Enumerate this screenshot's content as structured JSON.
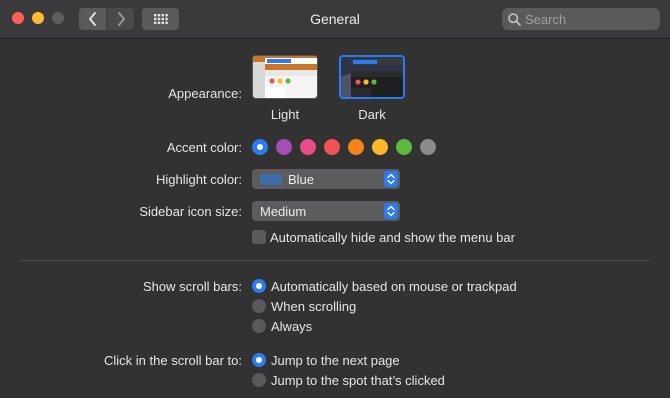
{
  "window": {
    "title": "General"
  },
  "toolbar": {
    "search_placeholder": "Search"
  },
  "appearance": {
    "label": "Appearance:",
    "options": [
      {
        "name": "Light",
        "selected": false
      },
      {
        "name": "Dark",
        "selected": true
      }
    ]
  },
  "accent_color": {
    "label": "Accent color:",
    "colors": [
      {
        "name": "blue",
        "hex": "#2b7bf3",
        "selected": true
      },
      {
        "name": "purple",
        "hex": "#a24fb6"
      },
      {
        "name": "pink",
        "hex": "#e84d8a"
      },
      {
        "name": "red",
        "hex": "#f15253"
      },
      {
        "name": "orange",
        "hex": "#f7821b"
      },
      {
        "name": "yellow",
        "hex": "#fbb829"
      },
      {
        "name": "green",
        "hex": "#5fb83e"
      },
      {
        "name": "graphite",
        "hex": "#8c8c8c"
      }
    ]
  },
  "highlight_color": {
    "label": "Highlight color:",
    "value": "Blue",
    "swatch": "#3e6ca8"
  },
  "sidebar_icon_size": {
    "label": "Sidebar icon size:",
    "value": "Medium"
  },
  "menu_bar": {
    "label": "Automatically hide and show the menu bar",
    "checked": false
  },
  "scroll_bars": {
    "label": "Show scroll bars:",
    "options": [
      {
        "label": "Automatically based on mouse or trackpad",
        "selected": true
      },
      {
        "label": "When scrolling",
        "selected": false
      },
      {
        "label": "Always",
        "selected": false
      }
    ]
  },
  "click_scroll": {
    "label": "Click in the scroll bar to:",
    "options": [
      {
        "label": "Jump to the next page",
        "selected": true
      },
      {
        "label": "Jump to the spot that’s clicked",
        "selected": false
      }
    ]
  }
}
